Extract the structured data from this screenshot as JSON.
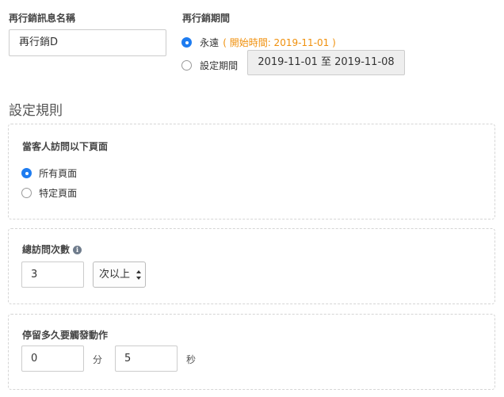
{
  "remarketing_name": {
    "label": "再行銷訊息名稱",
    "value": "再行銷D"
  },
  "remarketing_period": {
    "label": "再行銷期間",
    "forever_label": "永遠",
    "forever_note": "( 開始時間: 2019-11-01 )",
    "custom_label": "設定期間",
    "date_range": "2019-11-01 至 2019-11-08",
    "selected": "forever"
  },
  "rules": {
    "title": "設定規則",
    "pages": {
      "label": "當客人訪問以下頁面",
      "options": [
        "所有頁面",
        "特定頁面"
      ],
      "selected": "所有頁面"
    },
    "visits": {
      "label": "總訪問次數",
      "info_icon": "info-icon",
      "value": "3",
      "operator": "次以上"
    },
    "dwell": {
      "label": "停留多久要觸發動作",
      "minutes": "0",
      "minutes_unit": "分",
      "seconds": "5",
      "seconds_unit": "秒"
    }
  },
  "colors": {
    "accent": "#1e7cf0",
    "note": "#f0900c",
    "border_dashed": "#d5d5d5"
  }
}
